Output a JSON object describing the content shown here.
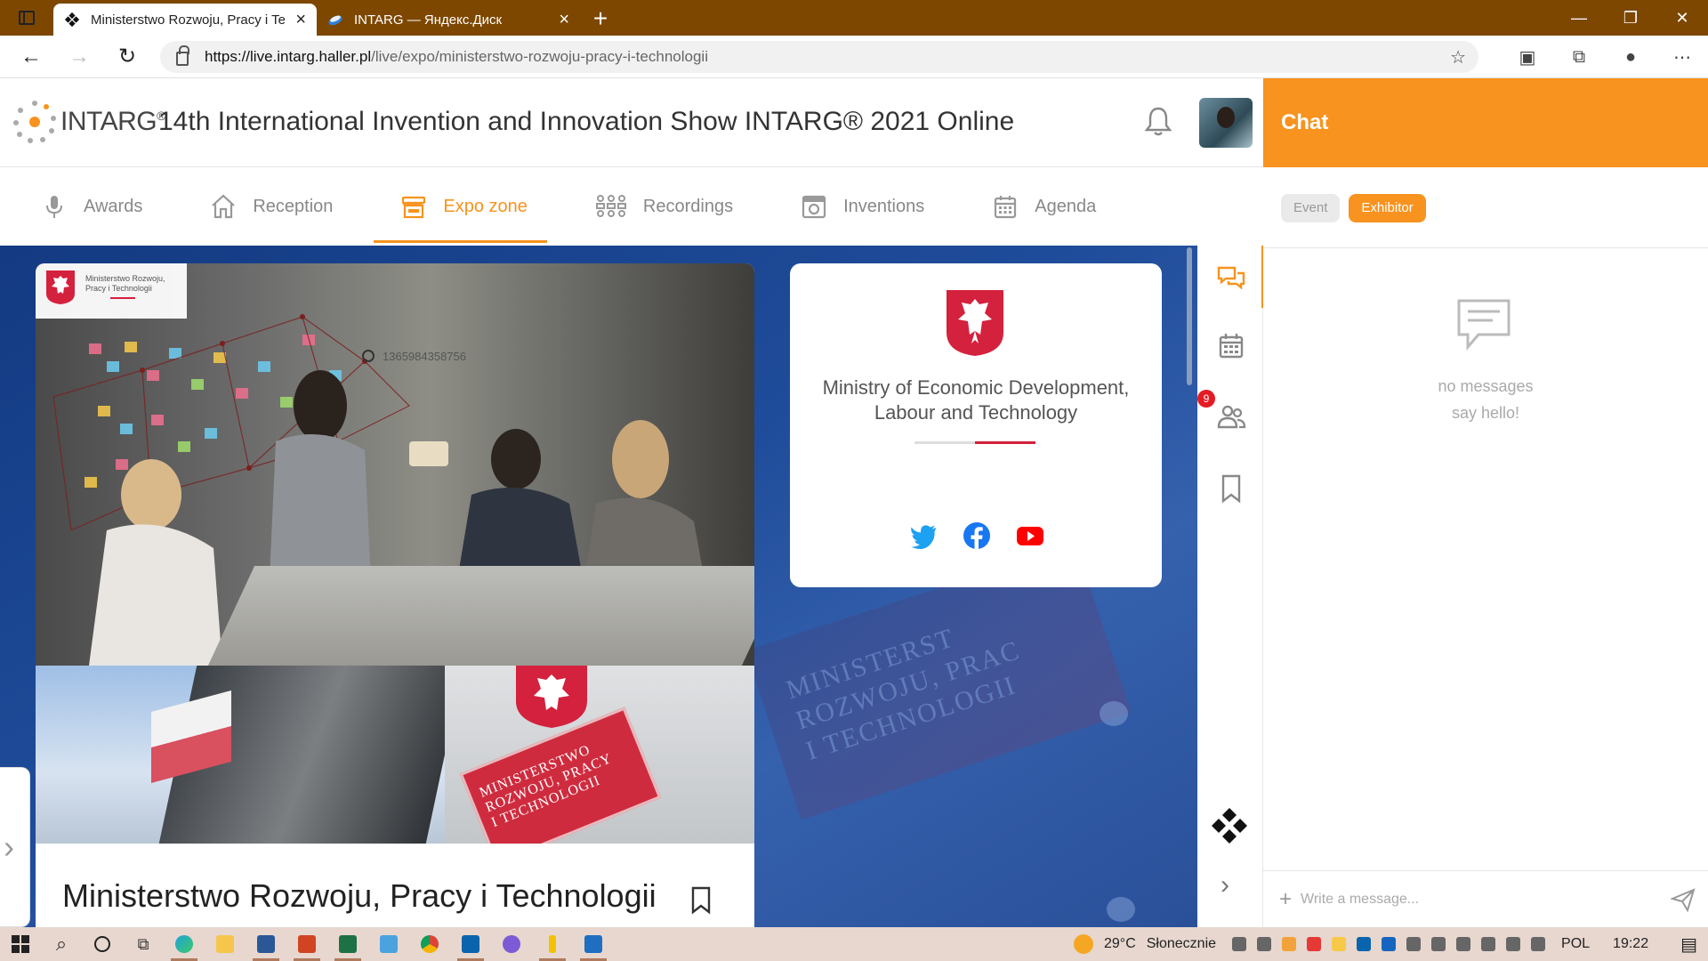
{
  "browser": {
    "tabs": [
      {
        "title": "Ministerstwo Rozwoju, Pracy i Technologii",
        "active": true
      },
      {
        "title": "INTARG — Яндекс.Диск",
        "active": false
      }
    ],
    "url_host": "https://live.intarg.haller.pl",
    "url_path": "/live/expo/ministerstwo-rozwoju-pracy-i-technologii"
  },
  "header": {
    "brand": "INTARG",
    "brand_mark": "®",
    "event_title": "14th International Invention and Innovation Show INTARG® 2021 Online"
  },
  "nav": {
    "items": [
      {
        "label": "Awards",
        "icon": "microphone-icon"
      },
      {
        "label": "Reception",
        "icon": "home-icon"
      },
      {
        "label": "Expo zone",
        "icon": "store-icon",
        "active": true
      },
      {
        "label": "Recordings",
        "icon": "people-grid-icon"
      },
      {
        "label": "Inventions",
        "icon": "device-icon"
      },
      {
        "label": "Agenda",
        "icon": "calendar-icon"
      }
    ]
  },
  "exhibitor": {
    "logo_text": "Ministerstwo Rozwoju, Pracy i Technologii",
    "photo_overlay_text": "1365984358756",
    "name_pl": "Ministerstwo Rozwoju, Pracy i Technologii",
    "name_en": "Ministry of Economic Development, Labour and Technology",
    "plaque_text": "MINISTERSTWO\nROZWOJU, PRACY\nI TECHNOLOGII",
    "bg_plaque_text": "MINISTERST\nROZWOJU, PRAC\nI TECHNOLOGII",
    "social": [
      "twitter-icon",
      "facebook-icon",
      "youtube-icon"
    ]
  },
  "rail": {
    "attendees_badge": "9"
  },
  "chat": {
    "title": "Chat",
    "tabs": [
      {
        "label": "Event",
        "active": false
      },
      {
        "label": "Exhibitor",
        "active": true
      }
    ],
    "empty_title": "no messages",
    "empty_subtitle": "say hello!",
    "input_placeholder": "Write a message..."
  },
  "taskbar": {
    "temperature": "29°C",
    "weather": "Słonecznie",
    "language": "POL",
    "time": "19:22"
  },
  "colors": {
    "accent": "#f7931e",
    "badge": "#e51b24",
    "titlebar": "#7d4700",
    "expo_bg": "#1f4c9a",
    "poland_red": "#d4213d"
  }
}
